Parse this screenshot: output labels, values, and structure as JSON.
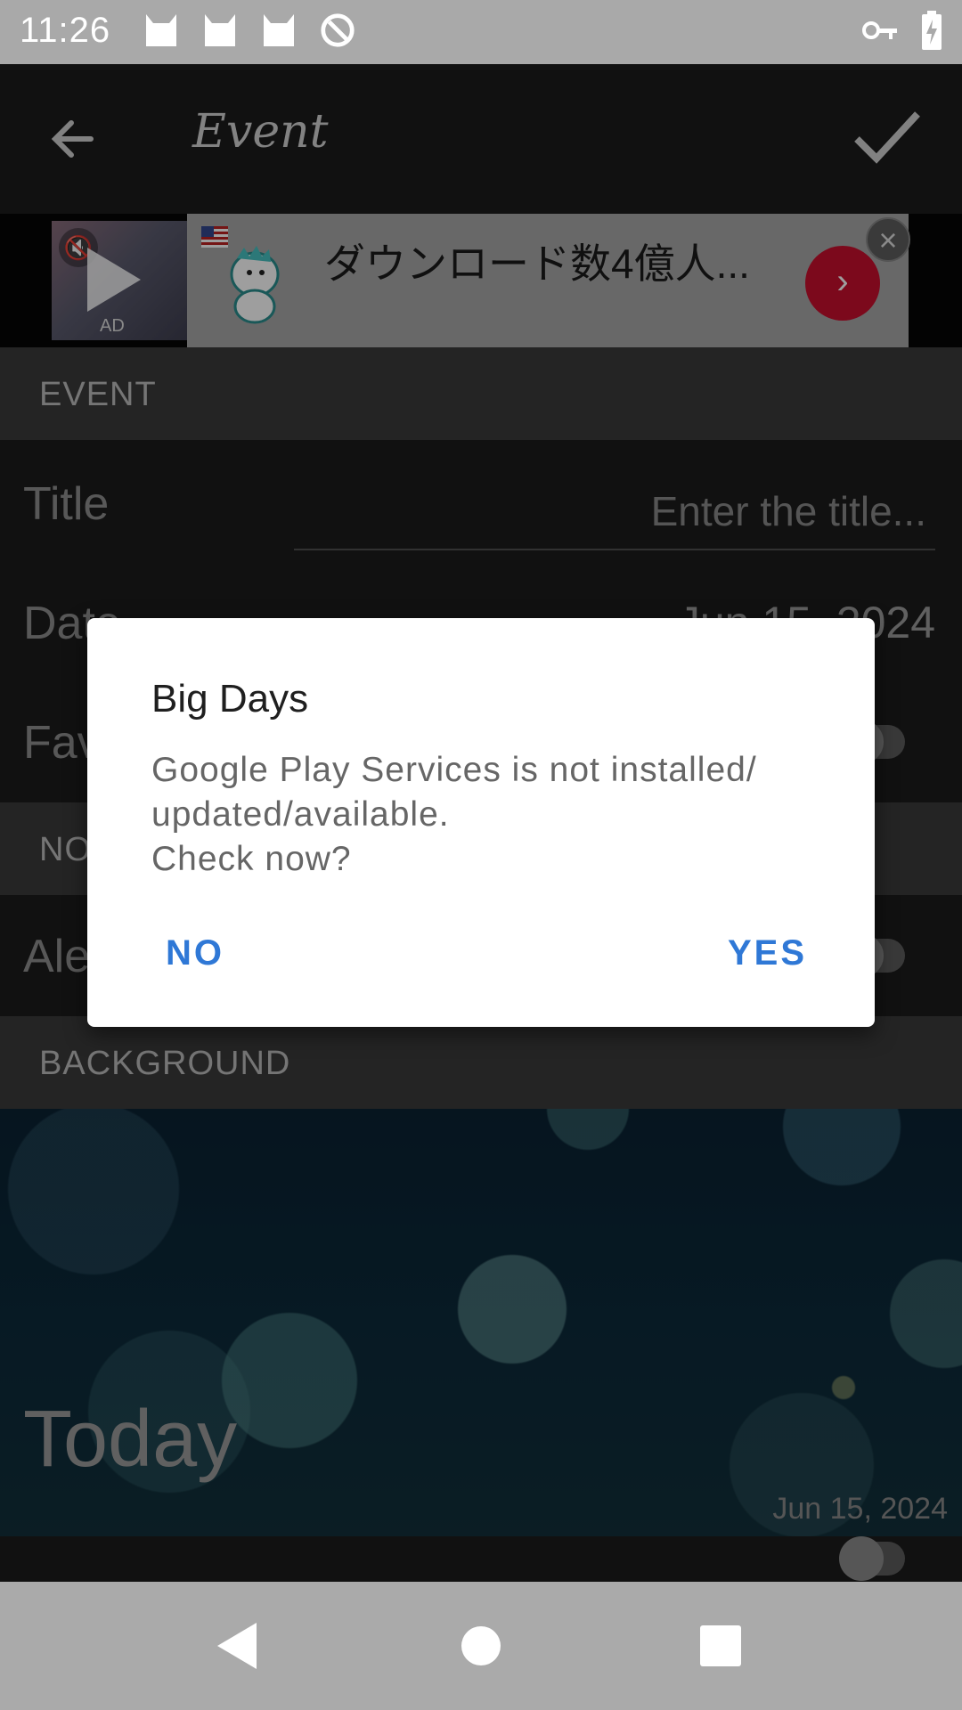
{
  "status_bar": {
    "time": "11:26",
    "icons": [
      "cat-notification-icon",
      "cat-notification-icon",
      "cat-notification-icon",
      "no-sync-icon",
      "vpn-key-icon",
      "battery-charging-icon"
    ]
  },
  "toolbar": {
    "title": "Event",
    "back_icon": "arrow-left-icon",
    "confirm_icon": "check-icon"
  },
  "ad": {
    "label": "AD",
    "headline": "ダウンロード数4億人...",
    "cta_glyph": "›",
    "close_glyph": "×"
  },
  "sections": {
    "event_header": "EVENT",
    "notification_header": "NO",
    "background_header": "BACKGROUND"
  },
  "form": {
    "title_label": "Title",
    "title_placeholder": "Enter the title...",
    "date_label": "Date",
    "date_value": "Jun 15, 2024",
    "favorite_label": "Fav",
    "alert_label": "Ale"
  },
  "background_preview": {
    "text": "Today",
    "date": "Jun 15, 2024"
  },
  "dialog": {
    "title": "Big Days",
    "message": "Google Play Services is not installed/\nupdated/available.\nCheck now?",
    "no_label": "NO",
    "yes_label": "YES"
  },
  "colors": {
    "accent": "#2f78d6",
    "ad_cta": "#c8102e"
  }
}
